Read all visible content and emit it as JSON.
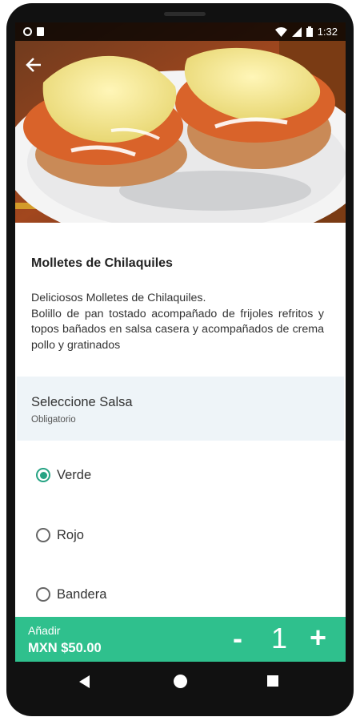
{
  "status_bar": {
    "time": "1:32"
  },
  "product": {
    "title": "Molletes de Chilaquiles",
    "description_line1": "Deliciosos Molletes de Chilaquiles.",
    "description_line2": "Bolillo de pan tostado acompañado de frijoles refritos y topos bañados en salsa casera y acompañados de crema pollo y gratinados"
  },
  "sauce_section": {
    "heading": "Seleccione Salsa",
    "subheading": "Obligatorio",
    "options": [
      {
        "label": "Verde",
        "selected": true
      },
      {
        "label": "Rojo",
        "selected": false
      },
      {
        "label": "Bandera",
        "selected": false
      }
    ]
  },
  "cart_bar": {
    "add_label": "Añadir",
    "price": "MXN $50.00",
    "minus": "-",
    "quantity": "1",
    "plus": "+"
  },
  "colors": {
    "accent": "#2fc08d",
    "radio_selected": "#26a383"
  }
}
